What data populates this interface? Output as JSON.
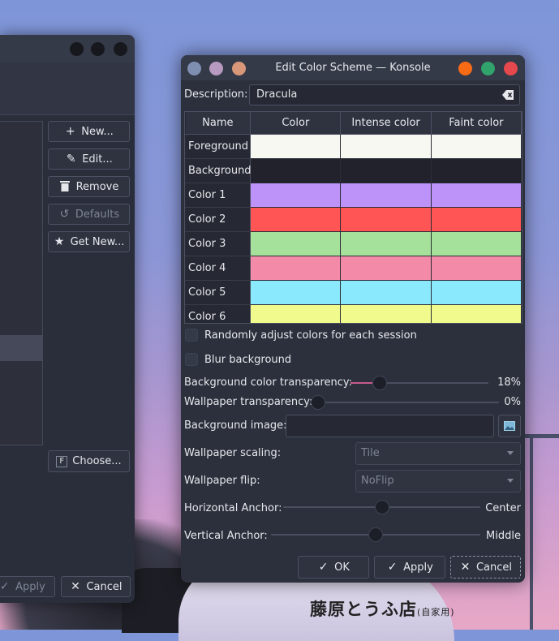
{
  "background_window": {
    "buttons": {
      "new": "New...",
      "edit": "Edit...",
      "remove": "Remove",
      "defaults": "Defaults",
      "get_new": "Get New...",
      "choose": "Choose..."
    },
    "footer": {
      "apply": "Apply",
      "cancel": "Cancel"
    }
  },
  "dialog": {
    "title": "Edit Color Scheme — Konsole",
    "description_label": "Description:",
    "description_value": "Dracula",
    "table": {
      "headers": [
        "Name",
        "Color",
        "Intense color",
        "Faint color"
      ],
      "rows": [
        {
          "name": "Foreground",
          "color": "#f8f8f2",
          "intense": "#f8f8f2",
          "faint": "#f8f8f2"
        },
        {
          "name": "Background",
          "color": "#21222c",
          "intense": "#21222c",
          "faint": "#21222c"
        },
        {
          "name": "Color 1",
          "color": "#bd93f9",
          "intense": "#bd93f9",
          "faint": "#bd93f9"
        },
        {
          "name": "Color 2",
          "color": "#ff5555",
          "intense": "#ff5555",
          "faint": "#ff5555"
        },
        {
          "name": "Color 3",
          "color": "#a5e19a",
          "intense": "#a5e19a",
          "faint": "#a5e19a"
        },
        {
          "name": "Color 4",
          "color": "#f28aa8",
          "intense": "#f28aa8",
          "faint": "#f28aa8"
        },
        {
          "name": "Color 5",
          "color": "#8be9fd",
          "intense": "#8be9fd",
          "faint": "#8be9fd"
        },
        {
          "name": "Color 6",
          "color": "#f1fa8c",
          "intense": "#f1fa8c",
          "faint": "#f1fa8c"
        }
      ]
    },
    "randomize_label": "Randomly adjust colors for each session",
    "blur_label": "Blur background",
    "bg_transparency_label": "Background color transparency:",
    "bg_transparency_value": "18%",
    "bg_transparency_level": 0.18,
    "wp_transparency_label": "Wallpaper transparency:",
    "wp_transparency_value": "0%",
    "wp_transparency_level": 0,
    "bg_image_label": "Background image:",
    "bg_image_value": "",
    "wp_scaling_label": "Wallpaper scaling:",
    "wp_scaling_value": "Tile",
    "wp_flip_label": "Wallpaper flip:",
    "wp_flip_value": "NoFlip",
    "h_anchor_label": "Horizontal Anchor:",
    "h_anchor_value": "Center",
    "h_anchor_level": 0.5,
    "v_anchor_label": "Vertical Anchor:",
    "v_anchor_value": "Middle",
    "v_anchor_level": 0.5,
    "ok_label": "OK",
    "apply_label": "Apply",
    "cancel_label": "Cancel"
  },
  "wallpaper": {
    "sign_text": "藤原とうふ店",
    "sign_small": "(自家用)"
  },
  "colors": {
    "traffic_close": "#e5484d",
    "traffic_max": "#30a46c",
    "traffic_min": "#f76b15",
    "accent": "#c65a8d"
  }
}
